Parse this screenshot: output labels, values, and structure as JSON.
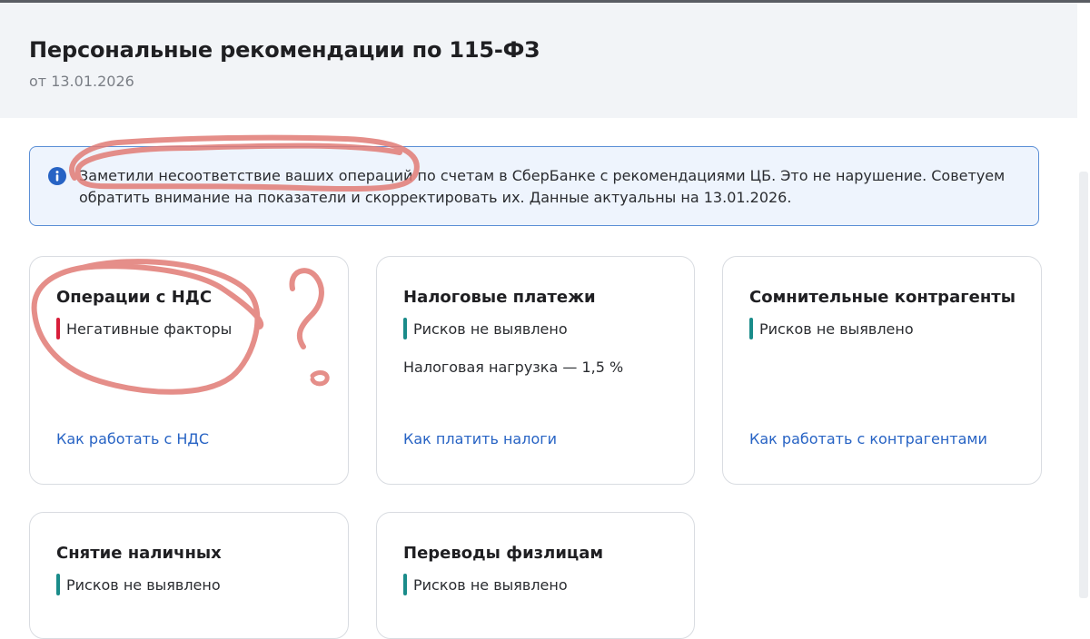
{
  "page": {
    "title": "Персональные рекомендации по 115-ФЗ",
    "date": "от 13.01.2026"
  },
  "notice": {
    "icon": "info-icon",
    "text": "Заметили несоответствие ваших операций по счетам в СберБанке с рекомендациями ЦБ. Это не нарушение. Советуем обратить внимание на показатели и скорректировать их. Данные актуальны на 13.01.2026."
  },
  "colors": {
    "negative": "#d81e3a",
    "ok": "#1a8c8a",
    "link": "#2763c4",
    "annotation": "#e07a74"
  },
  "cards": [
    {
      "title": "Операции с НДС",
      "status": "Негативные факторы",
      "status_type": "negative",
      "link": "Как работать с НДС"
    },
    {
      "title": "Налоговые платежи",
      "status": "Рисков не выявлено",
      "status_type": "ok",
      "note": "Налоговая нагрузка — 1,5 %",
      "link": "Как платить налоги"
    },
    {
      "title": "Сомнительные контрагенты",
      "status": "Рисков не выявлено",
      "status_type": "ok",
      "link": "Как работать с контрагентами"
    },
    {
      "title": "Снятие наличных",
      "status": "Рисков не выявлено",
      "status_type": "ok"
    },
    {
      "title": "Переводы физлицам",
      "status": "Рисков не выявлено",
      "status_type": "ok"
    }
  ]
}
